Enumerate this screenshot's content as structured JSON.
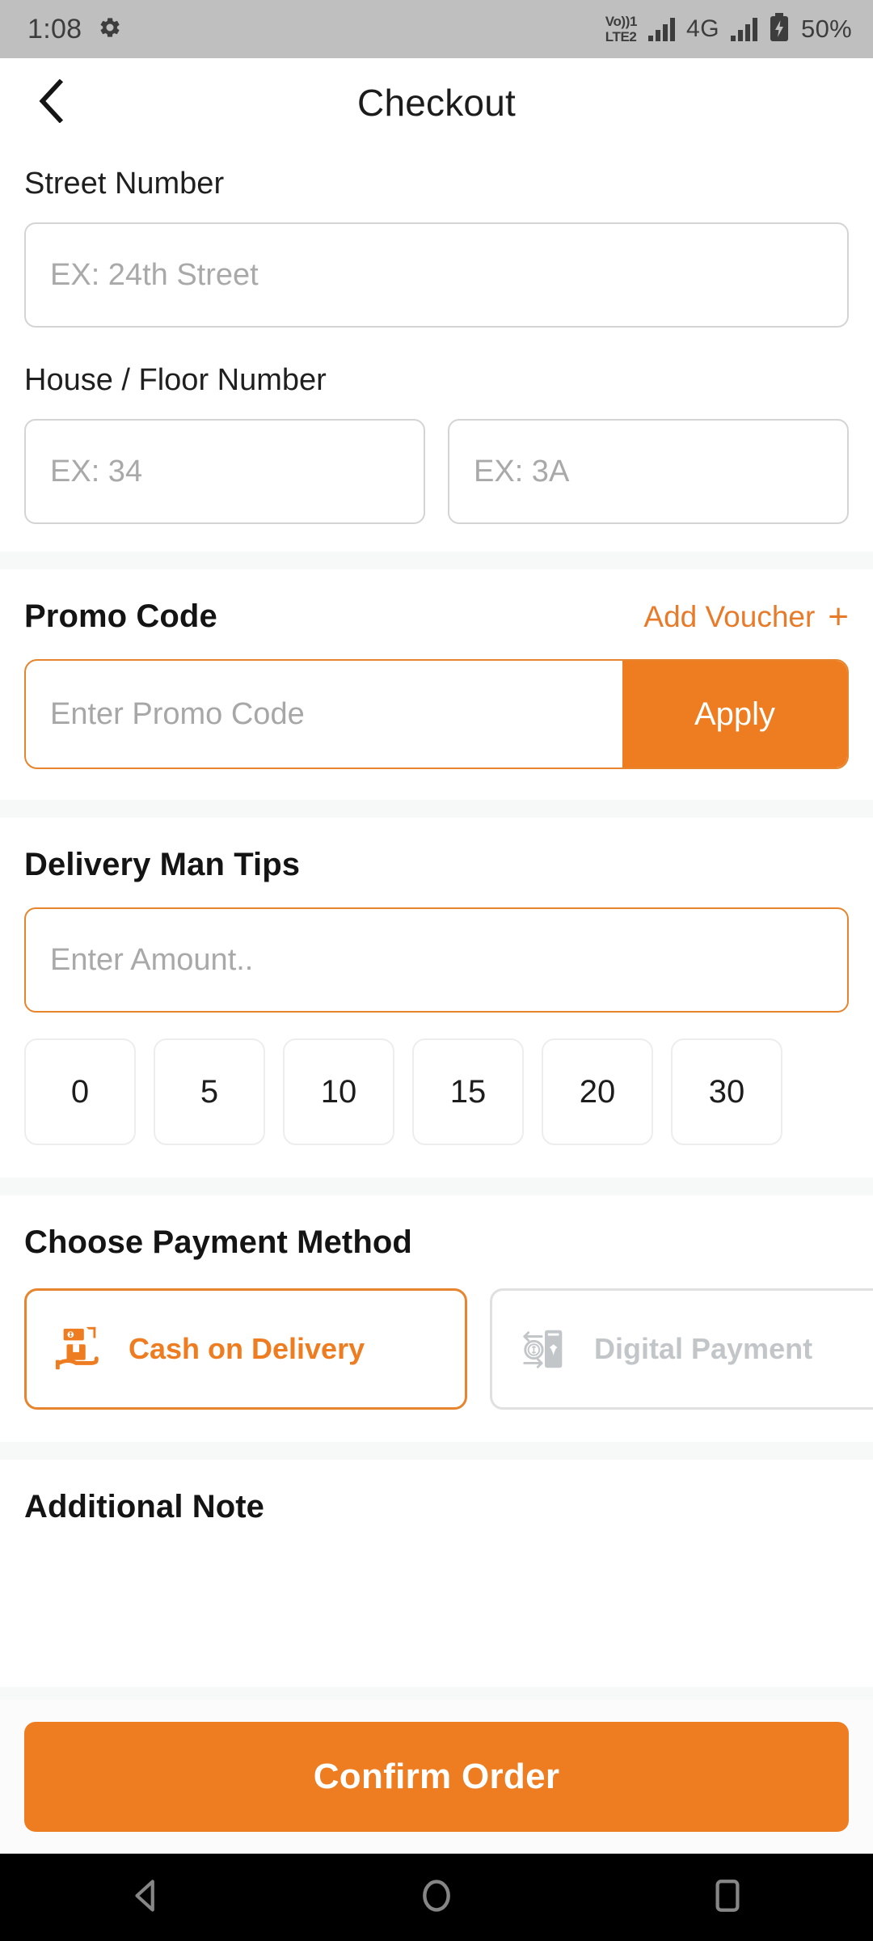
{
  "status_bar": {
    "clock": "1:08",
    "settings_icon": "gear-icon",
    "volte_line1": "Vo))1",
    "volte_line2": "LTE2",
    "network": "4G",
    "battery": "50%"
  },
  "app_bar": {
    "back_icon": "chevron-left-icon",
    "title": "Checkout"
  },
  "address": {
    "street_label": "Street Number",
    "street_placeholder": "EX: 24th Street",
    "house_label": "House / Floor Number",
    "house_placeholder": "EX: 34",
    "floor_placeholder": "EX: 3A"
  },
  "promo": {
    "title": "Promo Code",
    "add_voucher_label": "Add Voucher",
    "add_voucher_icon": "plus-icon",
    "placeholder": "Enter Promo Code",
    "value": "",
    "apply_label": "Apply"
  },
  "tips": {
    "title": "Delivery Man Tips",
    "placeholder": "Enter Amount..",
    "value": "",
    "options": [
      "0",
      "5",
      "10",
      "15",
      "20",
      "30"
    ]
  },
  "payment": {
    "title": "Choose Payment Method",
    "methods": [
      {
        "label": "Cash on Delivery",
        "icon": "cash-on-delivery-icon",
        "selected": true
      },
      {
        "label": "Digital Payment",
        "icon": "digital-payment-icon",
        "selected": false
      }
    ]
  },
  "note": {
    "title": "Additional Note"
  },
  "footer": {
    "confirm_label": "Confirm Order"
  },
  "nav_bar": {
    "back_icon": "triangle-back-icon",
    "home_icon": "circle-home-icon",
    "recents_icon": "square-recents-icon"
  },
  "colors": {
    "accent": "#EE7D21",
    "accent_border": "#E7852F",
    "muted": "#C2C6C9",
    "placeholder": "#A9A9A9",
    "section_bg": "#F7F8F8"
  }
}
